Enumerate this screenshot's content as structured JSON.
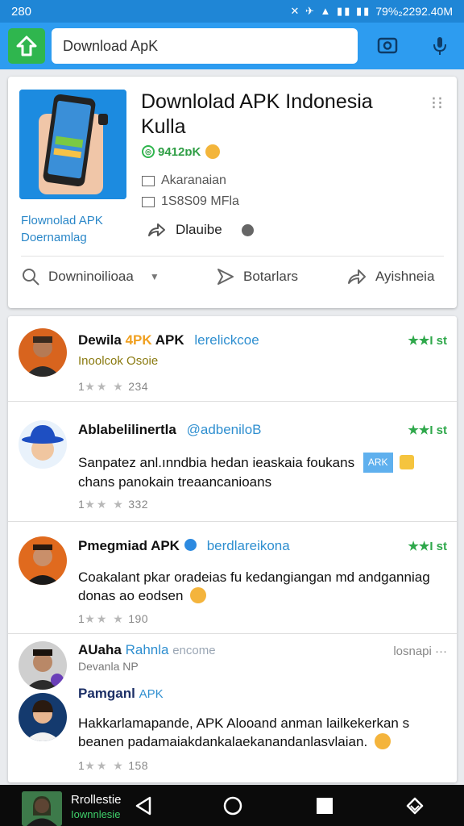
{
  "status_bar": {
    "time": "280",
    "right_text": "79%₂2292.40M",
    "icons": "✕ ✈ ▲ ▮▮ ▮▮"
  },
  "app_bar": {
    "search_value": "Download ApK",
    "search_placeholder": "Download ApK"
  },
  "feature": {
    "title": "Downlolad APK Indonesia Kulla",
    "rating": "9412ɒK",
    "publisher": "Akaranaian",
    "size": "1S8S09 MFla",
    "thumb_caption_1": "Flownolad APK",
    "thumb_caption_2": "Doernamlag",
    "share_label": "Dlauibe",
    "actions": [
      {
        "label": "Downinoilioaa"
      },
      {
        "label": "Botarlars"
      },
      {
        "label": "Ayishneia"
      }
    ],
    "colors": {
      "thumb_bg": "#1c8be0",
      "accent_green": "#2fb64e"
    }
  },
  "posts": [
    {
      "name_prefix": "Dewila",
      "name_highlight": "4PK",
      "name_suffix": "APK",
      "handle": "lerelickcoe",
      "stars": "★★I st",
      "subtitle": "Inoolcok Osoie",
      "footer_prefix": "1",
      "footer_count": "234"
    },
    {
      "name": "Ablabelilinertla",
      "handle": "@adbeniloB",
      "stars": "★★I st",
      "body_1": "Sanpatez anl.ınndbia hedan ieaskaia foukans",
      "chip": "ARK",
      "body_2": "chans panokain treaancanioans",
      "footer_prefix": "1",
      "footer_count": "332"
    },
    {
      "name": "Pmegmiad APK",
      "handle": "berdlareikona",
      "stars": "★★I st",
      "body": "Coakalant pkar oradeias fu kedangiangan md andganniag donas ao eodsen",
      "footer_prefix": "1",
      "footer_count": "190"
    },
    {
      "name": "AUaha",
      "name_blue": "Rahnla",
      "name_tail": "encome",
      "sub": "Devanla NP",
      "time": "losnapi ···",
      "name_2": "Pamganl",
      "name_2_blue": "APK",
      "body": "Hakkarlamapande, APK Alooand anman lailkekerkan s beanen padamaiakdankalaekanandanlasvlaian.",
      "footer_prefix": "1",
      "footer_count": "158"
    }
  ],
  "nav": {
    "label_1": "Rrollestie",
    "label_2": "Iownnlesie"
  }
}
